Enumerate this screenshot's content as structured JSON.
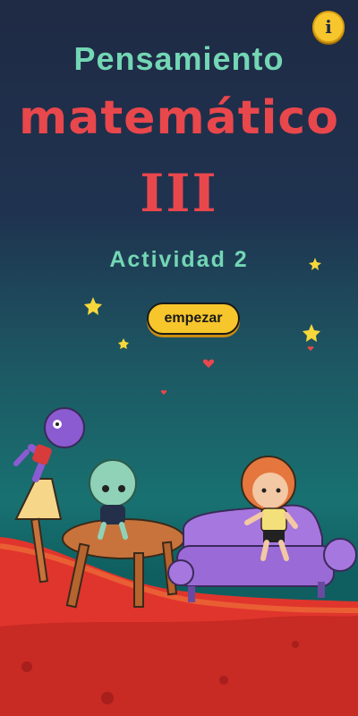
{
  "header": {
    "info_icon_glyph": "i"
  },
  "title": {
    "line1": "Pensamiento",
    "line2": "matemático",
    "line3": "III"
  },
  "activity_label": "Actividad 2",
  "start_button": {
    "label": "empezar"
  },
  "colors": {
    "title_teal": "#73d6b4",
    "title_red": "#e8474c",
    "button_yellow": "#f7c62c",
    "lava": "#e0352c"
  },
  "icons": [
    "info-icon",
    "star-icon",
    "heart-icon"
  ]
}
